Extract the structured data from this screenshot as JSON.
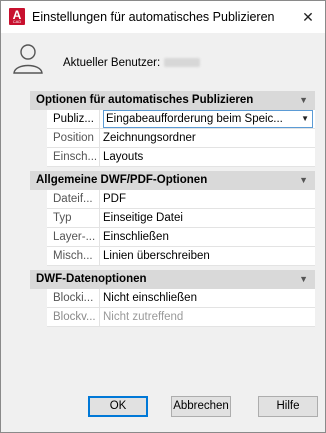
{
  "window": {
    "title": "Einstellungen für automatisches Publizieren",
    "app_icon_letter": "A",
    "app_icon_sub": "CAD",
    "close_glyph": "✕"
  },
  "user": {
    "label": "Aktueller Benutzer:",
    "icon": "user-icon"
  },
  "sections": [
    {
      "title": "Optionen für automatisches Publizieren",
      "rows": [
        {
          "key": "Publiz...",
          "value": "Eingabeaufforderung  beim  Speic..."
        },
        {
          "key": "Position",
          "value": "Zeichnungsordner"
        },
        {
          "key": "Einsch...",
          "value": "Layouts"
        }
      ]
    },
    {
      "title": "Allgemeine DWF/PDF-Optionen",
      "rows": [
        {
          "key": "Dateif...",
          "value": "PDF"
        },
        {
          "key": "Typ",
          "value": "Einseitige Datei"
        },
        {
          "key": "Layer-...",
          "value": "Einschließen"
        },
        {
          "key": "Misch...",
          "value": "Linien überschreiben"
        }
      ]
    },
    {
      "title": "DWF-Datenoptionen",
      "rows": [
        {
          "key": "Blocki...",
          "value": "Nicht einschließen"
        },
        {
          "key": "Blockv...",
          "value": "Nicht zutreffend"
        }
      ]
    }
  ],
  "buttons": {
    "ok": "OK",
    "cancel": "Abbrechen",
    "help": "Hilfe"
  },
  "colors": {
    "accent": "#0078d7",
    "section_bg": "#d9d9d9",
    "app_icon": "#c8102e"
  }
}
